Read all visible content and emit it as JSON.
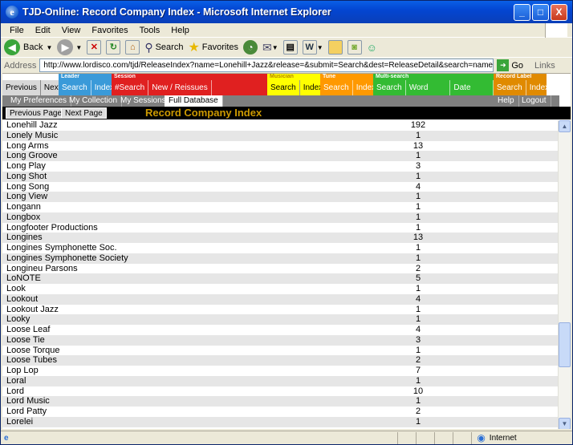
{
  "window": {
    "title": "TJD-Online: Record Company Index - Microsoft Internet Explorer",
    "minimize": "_",
    "maximize": "□",
    "close": "X"
  },
  "menu": [
    "File",
    "Edit",
    "View",
    "Favorites",
    "Tools",
    "Help"
  ],
  "toolbar": {
    "back": "Back",
    "search": "Search",
    "favorites": "Favorites"
  },
  "address": {
    "label": "Address",
    "url": "http://www.lordisco.com/tjd/ReleaseIndex?name=Lonehill+Jazz&release=&submit=Search&dest=ReleaseDetail&search=name&frame=both&select=true",
    "go": "Go",
    "links": "Links"
  },
  "nav": {
    "previous": "Previous",
    "next": "Next",
    "leader": {
      "header": "Leader",
      "search": "Search",
      "index": "Index"
    },
    "session": {
      "header": "Session",
      "search": "#Search",
      "new_reissues": "New / Reissues"
    },
    "musician": {
      "header": "Musician",
      "search": "Search",
      "index": "Index"
    },
    "tune": {
      "header": "Tune",
      "search": "Search",
      "index": "Index"
    },
    "multi": {
      "header": "Multi-search",
      "search": "Search",
      "word": "Word Search",
      "date": "Date Search"
    },
    "label": {
      "header": "Record Label",
      "search": "Search",
      "index": "Index"
    },
    "preferences": "My Preferences",
    "collection": "My Collection",
    "sessions": "My Sessions",
    "full_db": "Full Database",
    "help": "Help",
    "logout": "Logout"
  },
  "page": {
    "prev_page": "Previous Page",
    "next_page": "Next Page",
    "title": "Record Company Index"
  },
  "rows": [
    {
      "name": "Lonehill Jazz",
      "count": "192"
    },
    {
      "name": "Lonely Music",
      "count": "1"
    },
    {
      "name": "Long Arms",
      "count": "13"
    },
    {
      "name": "Long Groove",
      "count": "1"
    },
    {
      "name": "Long Play",
      "count": "3"
    },
    {
      "name": "Long Shot",
      "count": "1"
    },
    {
      "name": "Long Song",
      "count": "4"
    },
    {
      "name": "Long View",
      "count": "1"
    },
    {
      "name": "Longann",
      "count": "1"
    },
    {
      "name": "Longbox",
      "count": "1"
    },
    {
      "name": "Longfooter Productions",
      "count": "1"
    },
    {
      "name": "Longines",
      "count": "13"
    },
    {
      "name": "Longines Symphonette Soc.",
      "count": "1"
    },
    {
      "name": "Longines Symphonette Society",
      "count": "1"
    },
    {
      "name": "Longineu Parsons",
      "count": "2"
    },
    {
      "name": "LoNOTE",
      "count": "5"
    },
    {
      "name": "Look",
      "count": "1"
    },
    {
      "name": "Lookout",
      "count": "4"
    },
    {
      "name": "Lookout Jazz",
      "count": "1"
    },
    {
      "name": "Looky",
      "count": "1"
    },
    {
      "name": "Loose Leaf",
      "count": "4"
    },
    {
      "name": "Loose Tie",
      "count": "3"
    },
    {
      "name": "Loose Torque",
      "count": "1"
    },
    {
      "name": "Loose Tubes",
      "count": "2"
    },
    {
      "name": "Lop Lop",
      "count": "7"
    },
    {
      "name": "Loral",
      "count": "1"
    },
    {
      "name": "Lord",
      "count": "10"
    },
    {
      "name": "Lord Music",
      "count": "1"
    },
    {
      "name": "Lord Patty",
      "count": "2"
    },
    {
      "name": "Lorelei",
      "count": "1"
    }
  ],
  "status": {
    "zone": "Internet"
  },
  "colors": {
    "leader": "#3a9ad9",
    "session": "#e02020",
    "musician": "#ffff00",
    "tune": "#ff9900",
    "multi": "#33bb33",
    "label": "#e08a00",
    "title_text": "#cc9900"
  }
}
